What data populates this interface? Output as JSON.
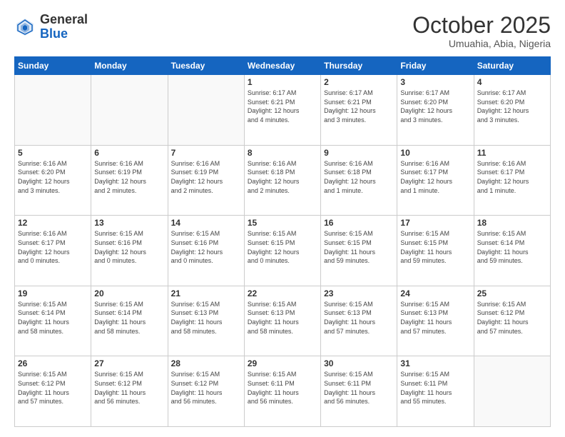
{
  "logo": {
    "general": "General",
    "blue": "Blue"
  },
  "header": {
    "month": "October 2025",
    "location": "Umuahia, Abia, Nigeria"
  },
  "weekdays": [
    "Sunday",
    "Monday",
    "Tuesday",
    "Wednesday",
    "Thursday",
    "Friday",
    "Saturday"
  ],
  "weeks": [
    [
      {
        "day": "",
        "info": ""
      },
      {
        "day": "",
        "info": ""
      },
      {
        "day": "",
        "info": ""
      },
      {
        "day": "1",
        "info": "Sunrise: 6:17 AM\nSunset: 6:21 PM\nDaylight: 12 hours\nand 4 minutes."
      },
      {
        "day": "2",
        "info": "Sunrise: 6:17 AM\nSunset: 6:21 PM\nDaylight: 12 hours\nand 3 minutes."
      },
      {
        "day": "3",
        "info": "Sunrise: 6:17 AM\nSunset: 6:20 PM\nDaylight: 12 hours\nand 3 minutes."
      },
      {
        "day": "4",
        "info": "Sunrise: 6:17 AM\nSunset: 6:20 PM\nDaylight: 12 hours\nand 3 minutes."
      }
    ],
    [
      {
        "day": "5",
        "info": "Sunrise: 6:16 AM\nSunset: 6:20 PM\nDaylight: 12 hours\nand 3 minutes."
      },
      {
        "day": "6",
        "info": "Sunrise: 6:16 AM\nSunset: 6:19 PM\nDaylight: 12 hours\nand 2 minutes."
      },
      {
        "day": "7",
        "info": "Sunrise: 6:16 AM\nSunset: 6:19 PM\nDaylight: 12 hours\nand 2 minutes."
      },
      {
        "day": "8",
        "info": "Sunrise: 6:16 AM\nSunset: 6:18 PM\nDaylight: 12 hours\nand 2 minutes."
      },
      {
        "day": "9",
        "info": "Sunrise: 6:16 AM\nSunset: 6:18 PM\nDaylight: 12 hours\nand 1 minute."
      },
      {
        "day": "10",
        "info": "Sunrise: 6:16 AM\nSunset: 6:17 PM\nDaylight: 12 hours\nand 1 minute."
      },
      {
        "day": "11",
        "info": "Sunrise: 6:16 AM\nSunset: 6:17 PM\nDaylight: 12 hours\nand 1 minute."
      }
    ],
    [
      {
        "day": "12",
        "info": "Sunrise: 6:16 AM\nSunset: 6:17 PM\nDaylight: 12 hours\nand 0 minutes."
      },
      {
        "day": "13",
        "info": "Sunrise: 6:15 AM\nSunset: 6:16 PM\nDaylight: 12 hours\nand 0 minutes."
      },
      {
        "day": "14",
        "info": "Sunrise: 6:15 AM\nSunset: 6:16 PM\nDaylight: 12 hours\nand 0 minutes."
      },
      {
        "day": "15",
        "info": "Sunrise: 6:15 AM\nSunset: 6:15 PM\nDaylight: 12 hours\nand 0 minutes."
      },
      {
        "day": "16",
        "info": "Sunrise: 6:15 AM\nSunset: 6:15 PM\nDaylight: 11 hours\nand 59 minutes."
      },
      {
        "day": "17",
        "info": "Sunrise: 6:15 AM\nSunset: 6:15 PM\nDaylight: 11 hours\nand 59 minutes."
      },
      {
        "day": "18",
        "info": "Sunrise: 6:15 AM\nSunset: 6:14 PM\nDaylight: 11 hours\nand 59 minutes."
      }
    ],
    [
      {
        "day": "19",
        "info": "Sunrise: 6:15 AM\nSunset: 6:14 PM\nDaylight: 11 hours\nand 58 minutes."
      },
      {
        "day": "20",
        "info": "Sunrise: 6:15 AM\nSunset: 6:14 PM\nDaylight: 11 hours\nand 58 minutes."
      },
      {
        "day": "21",
        "info": "Sunrise: 6:15 AM\nSunset: 6:13 PM\nDaylight: 11 hours\nand 58 minutes."
      },
      {
        "day": "22",
        "info": "Sunrise: 6:15 AM\nSunset: 6:13 PM\nDaylight: 11 hours\nand 58 minutes."
      },
      {
        "day": "23",
        "info": "Sunrise: 6:15 AM\nSunset: 6:13 PM\nDaylight: 11 hours\nand 57 minutes."
      },
      {
        "day": "24",
        "info": "Sunrise: 6:15 AM\nSunset: 6:13 PM\nDaylight: 11 hours\nand 57 minutes."
      },
      {
        "day": "25",
        "info": "Sunrise: 6:15 AM\nSunset: 6:12 PM\nDaylight: 11 hours\nand 57 minutes."
      }
    ],
    [
      {
        "day": "26",
        "info": "Sunrise: 6:15 AM\nSunset: 6:12 PM\nDaylight: 11 hours\nand 57 minutes."
      },
      {
        "day": "27",
        "info": "Sunrise: 6:15 AM\nSunset: 6:12 PM\nDaylight: 11 hours\nand 56 minutes."
      },
      {
        "day": "28",
        "info": "Sunrise: 6:15 AM\nSunset: 6:12 PM\nDaylight: 11 hours\nand 56 minutes."
      },
      {
        "day": "29",
        "info": "Sunrise: 6:15 AM\nSunset: 6:11 PM\nDaylight: 11 hours\nand 56 minutes."
      },
      {
        "day": "30",
        "info": "Sunrise: 6:15 AM\nSunset: 6:11 PM\nDaylight: 11 hours\nand 56 minutes."
      },
      {
        "day": "31",
        "info": "Sunrise: 6:15 AM\nSunset: 6:11 PM\nDaylight: 11 hours\nand 55 minutes."
      },
      {
        "day": "",
        "info": ""
      }
    ]
  ]
}
